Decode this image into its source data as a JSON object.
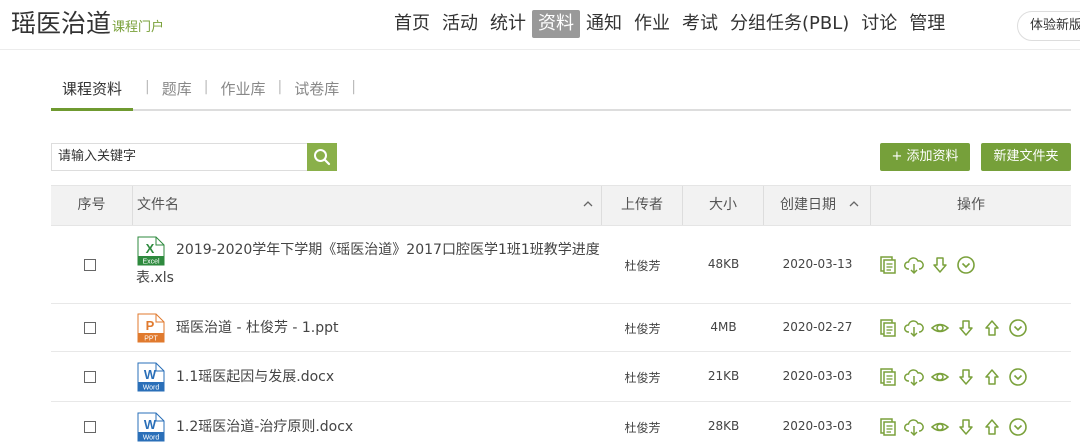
{
  "header": {
    "title": "瑶医治道",
    "subtitle": "课程门户",
    "nav": [
      "首页",
      "活动",
      "统计",
      "资料",
      "通知",
      "作业",
      "考试",
      "分组任务(PBL)",
      "讨论",
      "管理"
    ],
    "active_nav": "资料",
    "experience_button": "体验新版"
  },
  "subtabs": {
    "items": [
      "课程资料",
      "题库",
      "作业库",
      "试卷库"
    ],
    "active": "课程资料"
  },
  "search": {
    "value": "请输入关键字"
  },
  "buttons": {
    "add": "+ 添加资料",
    "new_folder": "新建文件夹"
  },
  "table": {
    "headers": [
      "序号",
      "文件名",
      "上传者",
      "大小",
      "创建日期",
      "操作"
    ],
    "rows": [
      {
        "name_line1": "2019-2020学年下学期《瑶医治道》2017口腔医学1班1班教学进度",
        "name_line2": "表.xls",
        "type": "excel",
        "type_label": "Excel",
        "uploader": "杜俊芳",
        "size": "48KB",
        "date": "2020-03-13",
        "ops": [
          "copy-icon",
          "cloud-download-icon",
          "download-icon",
          "more-icon"
        ]
      },
      {
        "name_line1": "瑶医治道 - 杜俊芳 - 1.ppt",
        "type": "ppt",
        "type_label": "PPT",
        "uploader": "杜俊芳",
        "size": "4MB",
        "date": "2020-02-27",
        "ops": [
          "copy-icon",
          "cloud-download-icon",
          "preview-icon",
          "download-icon",
          "upload-icon",
          "more-icon"
        ]
      },
      {
        "name_line1": "1.1瑶医起因与发展.docx",
        "type": "word",
        "type_label": "Word",
        "uploader": "杜俊芳",
        "size": "21KB",
        "date": "2020-03-03",
        "ops": [
          "copy-icon",
          "cloud-download-icon",
          "preview-icon",
          "download-icon",
          "upload-icon",
          "more-icon"
        ]
      },
      {
        "name_line1": "1.2瑶医治道-治疗原则.docx",
        "type": "word",
        "type_label": "Word",
        "uploader": "杜俊芳",
        "size": "28KB",
        "date": "2020-03-03",
        "ops": [
          "copy-icon",
          "cloud-download-icon",
          "preview-icon",
          "download-icon",
          "upload-icon",
          "more-icon"
        ]
      }
    ]
  },
  "colors": {
    "accent": "#76a03a",
    "excel": "#2e8a3e",
    "ppt": "#e07a2e",
    "word": "#2a6fb8"
  }
}
